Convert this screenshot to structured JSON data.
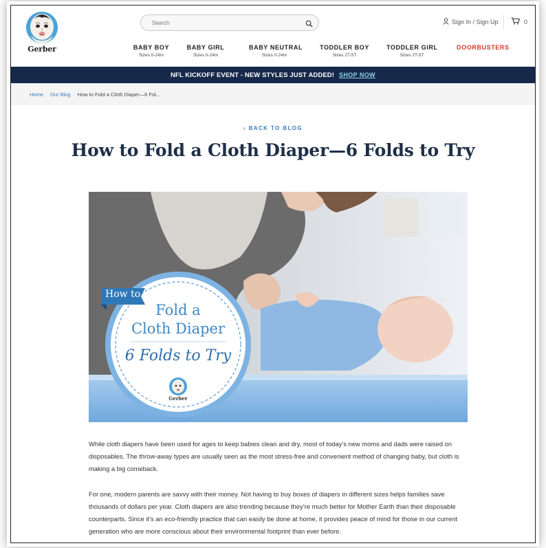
{
  "brand": {
    "name": "Gerber"
  },
  "search": {
    "placeholder": "Search"
  },
  "account": {
    "label": "Sign In / Sign Up"
  },
  "cart": {
    "count": "0"
  },
  "nav": [
    {
      "title": "BABY BOY",
      "sub": "Sizes 0-24m"
    },
    {
      "title": "BABY GIRL",
      "sub": "Sizes 0-24m"
    },
    {
      "title": "BABY NEUTRAL",
      "sub": "Sizes 0-24m"
    },
    {
      "title": "TODDLER BOY",
      "sub": "Sizes 2T-5T"
    },
    {
      "title": "TODDLER GIRL",
      "sub": "Sizes 2T-5T"
    },
    {
      "title": "DOORBUSTERS",
      "sub": ""
    }
  ],
  "promo": {
    "message": "NFL KICKOFF EVENT - NEW STYLES JUST ADDED!",
    "cta": "SHOP NOW"
  },
  "breadcrumb": {
    "home": "Home",
    "blog": "Our Blog",
    "current": "How to Fold a Cloth Diaper—6 Fol..."
  },
  "article": {
    "back": "‹ BACK TO BLOG",
    "title": "How to Fold a Cloth Diaper—6 Folds to Try",
    "hero": {
      "ribbon": "How to",
      "line1": "Fold a",
      "line2": "Cloth Diaper",
      "line3": "6 Folds to Try",
      "badge_brand": "Gerber"
    },
    "paragraphs": [
      "While cloth diapers have been used for ages to keep babies clean and dry, most of today’s new moms and dads were raised on disposables. The throw-away types are usually seen as the most stress-free and convenient method of changing baby, but cloth is making a big comeback.",
      "For one, modern parents are savvy with their money. Not having to buy boxes of diapers in different sizes helps families save thousands of dollars per year. Cloth diapers are also trending because they’re much better for Mother Earth than their disposable counterparts. Since it’s an eco-friendly practice that can easily be done at home, it provides peace of mind for those in our current generation who are more conscious about their environmental footprint than ever before."
    ]
  },
  "colors": {
    "navy": "#16294a",
    "link": "#3a7ebf",
    "doorbusters": "#d6392c",
    "badge_blue": "#6ea6dc"
  },
  "icons": [
    "gerber-baby-logo",
    "search-icon",
    "user-icon",
    "cart-icon"
  ]
}
